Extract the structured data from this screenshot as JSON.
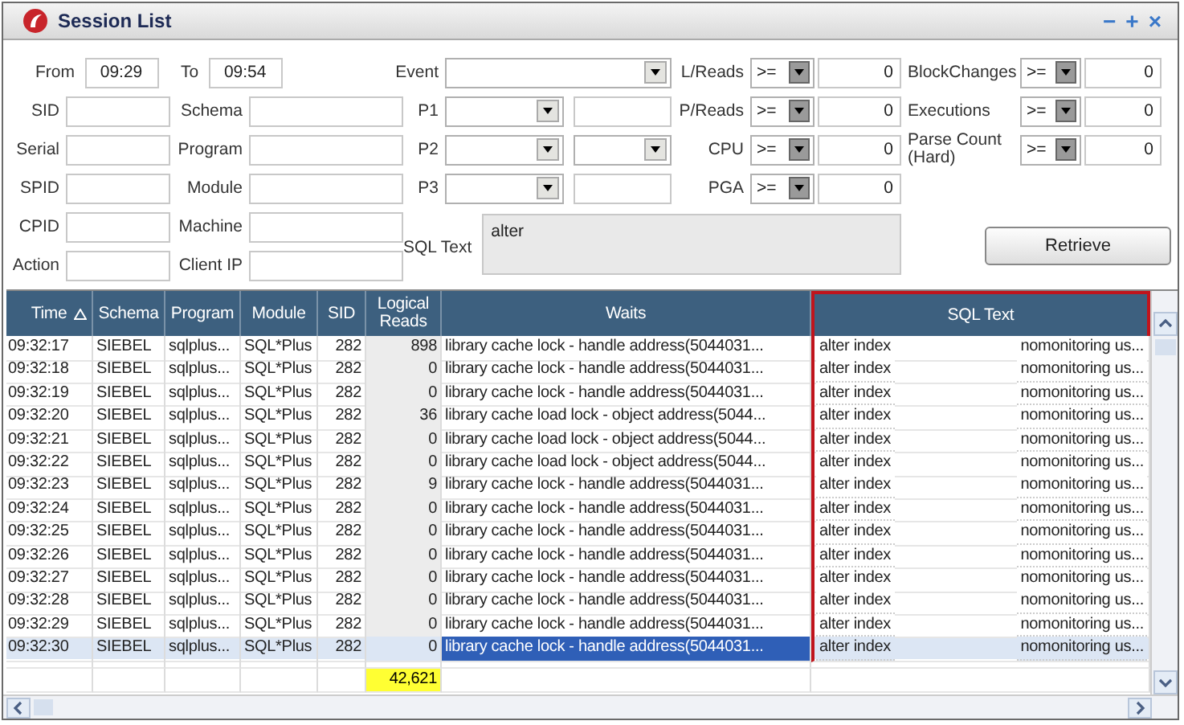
{
  "window": {
    "title": "Session List",
    "controls": [
      "−",
      "+",
      "×"
    ]
  },
  "time_range": [
    {
      "label": "From",
      "value": "09:29"
    },
    {
      "label": "To",
      "value": "09:54"
    }
  ],
  "id_fields": [
    {
      "label": "SID"
    },
    {
      "label": "Serial"
    },
    {
      "label": "SPID"
    },
    {
      "label": "CPID"
    },
    {
      "label": "Action"
    }
  ],
  "name_fields": [
    {
      "label": "Schema"
    },
    {
      "label": "Program"
    },
    {
      "label": "Module"
    },
    {
      "label": "Machine"
    },
    {
      "label": "Client IP"
    }
  ],
  "event": {
    "label": "Event"
  },
  "params": [
    {
      "label": "P1",
      "kind": "field"
    },
    {
      "label": "P2",
      "kind": "combo"
    },
    {
      "label": "P3",
      "kind": "field"
    }
  ],
  "sql_text": {
    "label": "SQL Text",
    "value": "alter"
  },
  "metrics_left": [
    {
      "label": "L/Reads",
      "operator": ">=",
      "value": "0"
    },
    {
      "label": "P/Reads",
      "operator": ">=",
      "value": "0"
    },
    {
      "label": "CPU",
      "operator": ">=",
      "value": "0"
    },
    {
      "label": "PGA",
      "operator": ">=",
      "value": "0"
    }
  ],
  "metrics_right": [
    {
      "label": "BlockChanges",
      "operator": ">=",
      "value": "0"
    },
    {
      "label": "Executions",
      "operator": ">=",
      "value": "0"
    },
    {
      "label": "Parse Count (Hard)",
      "operator": ">=",
      "value": "0"
    }
  ],
  "retrieve_button": "Retrieve",
  "table": {
    "columns": [
      {
        "label": "Time",
        "sorted": true,
        "highlighted": false
      },
      {
        "label": "Schema",
        "sorted": false,
        "highlighted": false
      },
      {
        "label": "Program",
        "sorted": false,
        "highlighted": false
      },
      {
        "label": "Module",
        "sorted": false,
        "highlighted": false
      },
      {
        "label": "SID",
        "sorted": false,
        "highlighted": false
      },
      {
        "label": "Logical Reads",
        "sorted": false,
        "highlighted": false
      },
      {
        "label": "Waits",
        "sorted": false,
        "highlighted": false
      },
      {
        "label": "SQL Text",
        "sorted": false,
        "highlighted": true
      }
    ],
    "rows": [
      {
        "time": "09:32:17",
        "schema": "SIEBEL",
        "program": "sqlplus...",
        "module": "SQL*Plus",
        "sid": "282",
        "logical_reads": "898",
        "waits": "library cache lock - handle address(5044031...",
        "sql_head": "alter index",
        "sql_tail": "nomonitoring us...",
        "selected": false
      },
      {
        "time": "09:32:18",
        "schema": "SIEBEL",
        "program": "sqlplus...",
        "module": "SQL*Plus",
        "sid": "282",
        "logical_reads": "0",
        "waits": "library cache lock - handle address(5044031...",
        "sql_head": "alter index",
        "sql_tail": "nomonitoring us...",
        "selected": false
      },
      {
        "time": "09:32:19",
        "schema": "SIEBEL",
        "program": "sqlplus...",
        "module": "SQL*Plus",
        "sid": "282",
        "logical_reads": "0",
        "waits": "library cache lock - handle address(5044031...",
        "sql_head": "alter index",
        "sql_tail": "nomonitoring us...",
        "selected": false
      },
      {
        "time": "09:32:20",
        "schema": "SIEBEL",
        "program": "sqlplus...",
        "module": "SQL*Plus",
        "sid": "282",
        "logical_reads": "36",
        "waits": "library cache load lock - object address(5044...",
        "sql_head": "alter index",
        "sql_tail": "nomonitoring us...",
        "selected": false
      },
      {
        "time": "09:32:21",
        "schema": "SIEBEL",
        "program": "sqlplus...",
        "module": "SQL*Plus",
        "sid": "282",
        "logical_reads": "0",
        "waits": "library cache load lock - object address(5044...",
        "sql_head": "alter index",
        "sql_tail": "nomonitoring us...",
        "selected": false
      },
      {
        "time": "09:32:22",
        "schema": "SIEBEL",
        "program": "sqlplus...",
        "module": "SQL*Plus",
        "sid": "282",
        "logical_reads": "0",
        "waits": "library cache load lock - object address(5044...",
        "sql_head": "alter index",
        "sql_tail": "nomonitoring us...",
        "selected": false
      },
      {
        "time": "09:32:23",
        "schema": "SIEBEL",
        "program": "sqlplus...",
        "module": "SQL*Plus",
        "sid": "282",
        "logical_reads": "9",
        "waits": "library cache lock - handle address(5044031...",
        "sql_head": "alter index",
        "sql_tail": "nomonitoring us...",
        "selected": false
      },
      {
        "time": "09:32:24",
        "schema": "SIEBEL",
        "program": "sqlplus...",
        "module": "SQL*Plus",
        "sid": "282",
        "logical_reads": "0",
        "waits": "library cache lock - handle address(5044031...",
        "sql_head": "alter index",
        "sql_tail": "nomonitoring us...",
        "selected": false
      },
      {
        "time": "09:32:25",
        "schema": "SIEBEL",
        "program": "sqlplus...",
        "module": "SQL*Plus",
        "sid": "282",
        "logical_reads": "0",
        "waits": "library cache lock - handle address(5044031...",
        "sql_head": "alter index",
        "sql_tail": "nomonitoring us...",
        "selected": false
      },
      {
        "time": "09:32:26",
        "schema": "SIEBEL",
        "program": "sqlplus...",
        "module": "SQL*Plus",
        "sid": "282",
        "logical_reads": "0",
        "waits": "library cache lock - handle address(5044031...",
        "sql_head": "alter index",
        "sql_tail": "nomonitoring us...",
        "selected": false
      },
      {
        "time": "09:32:27",
        "schema": "SIEBEL",
        "program": "sqlplus...",
        "module": "SQL*Plus",
        "sid": "282",
        "logical_reads": "0",
        "waits": "library cache lock - handle address(5044031...",
        "sql_head": "alter index",
        "sql_tail": "nomonitoring us...",
        "selected": false
      },
      {
        "time": "09:32:28",
        "schema": "SIEBEL",
        "program": "sqlplus...",
        "module": "SQL*Plus",
        "sid": "282",
        "logical_reads": "0",
        "waits": "library cache lock - handle address(5044031...",
        "sql_head": "alter index",
        "sql_tail": "nomonitoring us...",
        "selected": false
      },
      {
        "time": "09:32:29",
        "schema": "SIEBEL",
        "program": "sqlplus...",
        "module": "SQL*Plus",
        "sid": "282",
        "logical_reads": "0",
        "waits": "library cache lock - handle address(5044031...",
        "sql_head": "alter index",
        "sql_tail": "nomonitoring us...",
        "selected": false
      },
      {
        "time": "09:32:30",
        "schema": "SIEBEL",
        "program": "sqlplus...",
        "module": "SQL*Plus",
        "sid": "282",
        "logical_reads": "0",
        "waits": "library cache lock - handle address(5044031...",
        "sql_head": "alter index",
        "sql_tail": "nomonitoring us...",
        "selected": true
      }
    ],
    "totals": {
      "logical_reads": "42,621"
    }
  }
}
